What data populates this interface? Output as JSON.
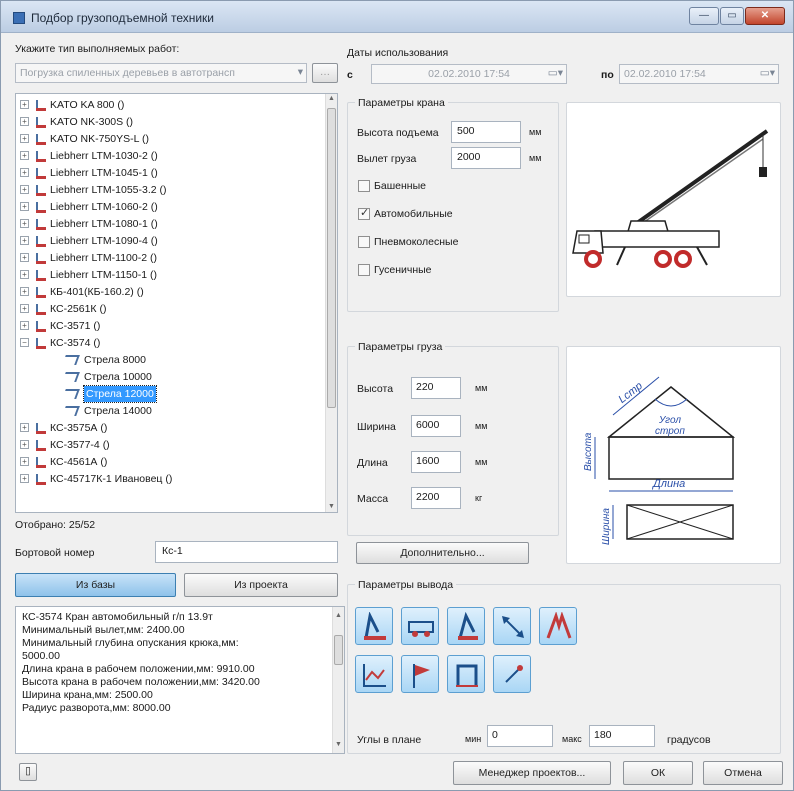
{
  "window": {
    "title": "Подбор грузоподъемной техники",
    "controls": {
      "minimize": "—",
      "maximize": "▭",
      "close": "✕"
    }
  },
  "left": {
    "work_type_label": "Укажите тип выполняемых работ:",
    "work_type_value": "Погрузка спиленных деревьев в автотрансп",
    "tree": [
      {
        "label": "KATO KA 800 ()",
        "level": 0,
        "expander": "+",
        "icon": "crane-icon"
      },
      {
        "label": "KATO NK-300S ()",
        "level": 0,
        "expander": "+",
        "icon": "crane-icon"
      },
      {
        "label": "KATO NK-750YS-L ()",
        "level": 0,
        "expander": "+",
        "icon": "crane-icon"
      },
      {
        "label": "Liebherr LTM-1030-2 ()",
        "level": 0,
        "expander": "+",
        "icon": "crane-icon"
      },
      {
        "label": "Liebherr LTM-1045-1 ()",
        "level": 0,
        "expander": "+",
        "icon": "crane-icon"
      },
      {
        "label": "Liebherr LTM-1055-3.2 ()",
        "level": 0,
        "expander": "+",
        "icon": "crane-icon"
      },
      {
        "label": "Liebherr LTM-1060-2 ()",
        "level": 0,
        "expander": "+",
        "icon": "crane-icon"
      },
      {
        "label": "Liebherr LTM-1080-1 ()",
        "level": 0,
        "expander": "+",
        "icon": "crane-icon"
      },
      {
        "label": "Liebherr LTM-1090-4 ()",
        "level": 0,
        "expander": "+",
        "icon": "crane-icon"
      },
      {
        "label": "Liebherr LTM-1100-2 ()",
        "level": 0,
        "expander": "+",
        "icon": "crane-icon"
      },
      {
        "label": "Liebherr LTM-1150-1 ()",
        "level": 0,
        "expander": "+",
        "icon": "crane-icon"
      },
      {
        "label": "КБ-401(КБ-160.2) ()",
        "level": 0,
        "expander": "+",
        "icon": "crane-icon"
      },
      {
        "label": "КС-2561К ()",
        "level": 0,
        "expander": "+",
        "icon": "crane-icon"
      },
      {
        "label": "КС-3571 ()",
        "level": 0,
        "expander": "+",
        "icon": "crane-icon"
      },
      {
        "label": "КС-3574 ()",
        "level": 0,
        "expander": "−",
        "icon": "crane-icon"
      },
      {
        "label": "Стрела 8000",
        "level": 1,
        "expander": "",
        "icon": "boom-icon"
      },
      {
        "label": "Стрела 10000",
        "level": 1,
        "expander": "",
        "icon": "boom-icon"
      },
      {
        "label": "Стрела 12000",
        "level": 1,
        "expander": "",
        "icon": "boom-icon",
        "selected": true
      },
      {
        "label": "Стрела 14000",
        "level": 1,
        "expander": "",
        "icon": "boom-icon"
      },
      {
        "label": "КС-3575А ()",
        "level": 0,
        "expander": "+",
        "icon": "crane-icon"
      },
      {
        "label": "КС-3577-4 ()",
        "level": 0,
        "expander": "+",
        "icon": "crane-icon"
      },
      {
        "label": "КС-4561А ()",
        "level": 0,
        "expander": "+",
        "icon": "crane-icon"
      },
      {
        "label": "КС-45717К-1 Ивановец ()",
        "level": 0,
        "expander": "+",
        "icon": "crane-icon"
      }
    ],
    "shown_label": "Отобрано: 25/52",
    "board_number_label": "Бортовой номер",
    "board_number_value": "Кс-1",
    "from_db_button": "Из базы",
    "from_project_button": "Из проекта",
    "info_lines": [
      "КС-3574 Кран автомобильный г/п 13.9т",
      "Минимальный вылет,мм: 2400.00",
      "Минимальный глубина опускания крюка,мм:",
      "5000.00",
      "Длина крана в рабочем положении,мм: 9910.00",
      "Высота крана в рабочем положении,мм: 3420.00",
      "Ширина крана,мм: 2500.00",
      "Радиус разворота,мм: 8000.00"
    ]
  },
  "dates": {
    "label": "Даты использования",
    "from_label": "с",
    "from_value": "02.02.2010 17:54",
    "to_label": "по",
    "to_value": "02.02.2010 17:54"
  },
  "crane_params": {
    "title": "Параметры крана",
    "lift_height_label": "Высота подъема",
    "lift_height_value": "500",
    "reach_label": "Вылет груза",
    "reach_value": "2000",
    "unit": "мм",
    "types": [
      {
        "label": "Башенные",
        "checked": false
      },
      {
        "label": "Автомобильные",
        "checked": true
      },
      {
        "label": "Пневмоколесные",
        "checked": false
      },
      {
        "label": "Гусеничные",
        "checked": false
      }
    ]
  },
  "cargo_params": {
    "title": "Параметры груза",
    "height_label": "Высота",
    "height_value": "220",
    "width_label": "Ширина",
    "width_value": "6000",
    "length_label": "Длина",
    "length_value": "1600",
    "mass_label": "Масса",
    "mass_value": "2200",
    "unit_mm": "мм",
    "unit_kg": "кг",
    "more_button": "Дополнительно...",
    "diagram": {
      "sling_label": "Lстр",
      "angle_label_1": "Угол",
      "angle_label_2": "строп",
      "height_label": "Высота",
      "length_label": "Длина",
      "width_label": "Ширина"
    }
  },
  "output_params": {
    "title": "Параметры вывода",
    "angles_label": "Углы в плане",
    "min_label": "мин",
    "min_value": "0",
    "max_label": "макс",
    "max_value": "180",
    "degrees_label": "градусов"
  },
  "footer": {
    "project_manager_button": "Менеджер проектов...",
    "ok_button": "ОК",
    "cancel_button": "Отмена"
  }
}
